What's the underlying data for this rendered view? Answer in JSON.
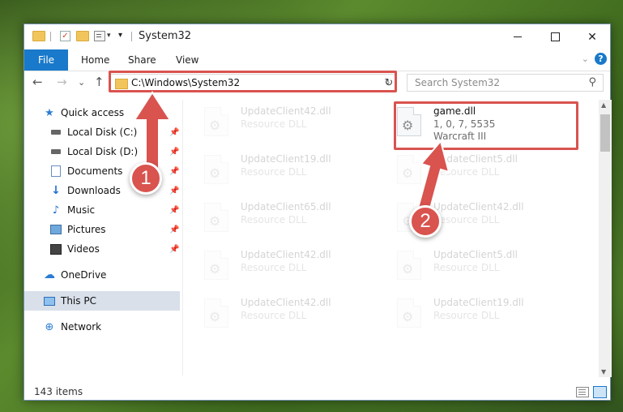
{
  "window": {
    "title": "System32",
    "quick_access_toolbar": {
      "customize_caret": "▾",
      "caret": "▾"
    },
    "controls": {
      "close": "✕"
    }
  },
  "ribbon": {
    "tabs": [
      {
        "label": "File",
        "active": true
      },
      {
        "label": "Home"
      },
      {
        "label": "Share"
      },
      {
        "label": "View"
      }
    ],
    "expand_glyph": "⌄",
    "help_glyph": "?"
  },
  "navigation": {
    "back": "←",
    "forward": "→",
    "recent": "⌄",
    "up": "↑",
    "address": "C:\\Windows\\System32",
    "address_dropdown": "⌄",
    "refresh": "↻",
    "search_placeholder": "Search System32",
    "search_glyph": "⚲"
  },
  "sidebar": {
    "items": [
      {
        "label": "Quick access",
        "icon": "star-icon"
      },
      {
        "label": "Local Disk (C:)",
        "icon": "drive-icon",
        "pinned": true
      },
      {
        "label": "Local Disk (D:)",
        "icon": "drive-icon",
        "pinned": true
      },
      {
        "label": "Documents",
        "icon": "document-icon",
        "pinned": true
      },
      {
        "label": "Downloads",
        "icon": "download-icon",
        "pinned": true
      },
      {
        "label": "Music",
        "icon": "music-icon",
        "pinned": true
      },
      {
        "label": "Pictures",
        "icon": "pictures-icon",
        "pinned": true
      },
      {
        "label": "Videos",
        "icon": "video-icon",
        "pinned": true
      },
      {
        "label": "OneDrive",
        "icon": "cloud-icon"
      },
      {
        "label": "This PC",
        "icon": "computer-icon",
        "selected": true
      },
      {
        "label": "Network",
        "icon": "network-icon"
      }
    ],
    "pin_glyph": "📌"
  },
  "files": [
    {
      "name": "UpdateClient42.dll",
      "type": "Resource DLL",
      "faded": true
    },
    {
      "name": "game.dll",
      "version": "1, 0, 7, 5535",
      "product": "Warcraft III",
      "faded": false
    },
    {
      "name": "UpdateClient19.dll",
      "type": "Resource DLL",
      "faded": true
    },
    {
      "name": "UpdateClient5.dll",
      "type": "Resource DLL",
      "faded": true
    },
    {
      "name": "UpdateClient65.dll",
      "type": "Resource DLL",
      "faded": true
    },
    {
      "name": "UpdateClient42.dll",
      "type": "Resource DLL",
      "faded": true
    },
    {
      "name": "UpdateClient42.dll",
      "type": "Resource DLL",
      "faded": true
    },
    {
      "name": "UpdateClient5.dll",
      "type": "Resource DLL",
      "faded": true
    },
    {
      "name": "UpdateClient42.dll",
      "type": "Resource DLL",
      "faded": true
    },
    {
      "name": "UpdateClient19.dll",
      "type": "Resource DLL",
      "faded": true
    }
  ],
  "file_icon_glyph": "⚙",
  "status": {
    "item_count": "143 items"
  },
  "scrollbar": {
    "up": "▲",
    "down": "▼"
  },
  "callouts": [
    {
      "number": "1",
      "target": "address bar"
    },
    {
      "number": "2",
      "target": "game.dll"
    }
  ],
  "colors": {
    "accent": "#1979ca",
    "callout": "#d9534f",
    "selection": "#d9e0ea"
  }
}
